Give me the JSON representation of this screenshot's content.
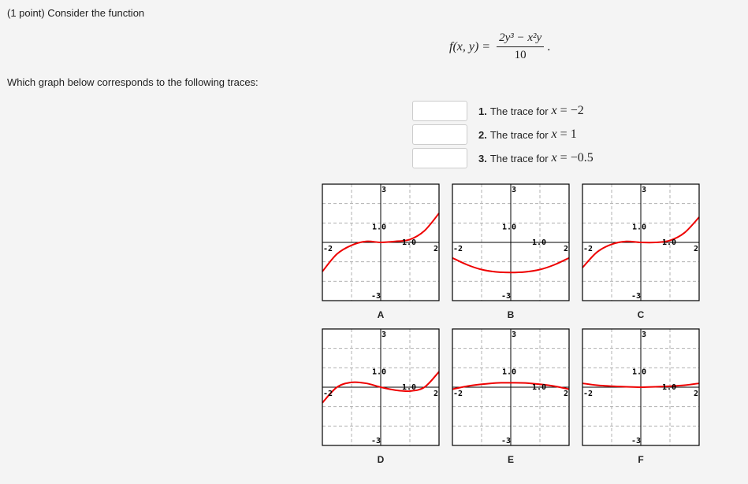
{
  "header": {
    "intro": "(1 point) Consider the function",
    "question": "Which graph below corresponds to the following traces:"
  },
  "formula": {
    "lhs": "f(x, y) =",
    "numerator": "2y³ − x²y",
    "denominator": "10",
    "trailing": "."
  },
  "items": [
    {
      "number": "1.",
      "text": "The trace for",
      "var": "x",
      "eq": "=",
      "value": "−2",
      "answer": ""
    },
    {
      "number": "2.",
      "text": "The trace for",
      "var": "x",
      "eq": "=",
      "value": "1",
      "answer": ""
    },
    {
      "number": "3.",
      "text": "The trace for",
      "var": "x",
      "eq": "=",
      "value": "−0.5",
      "answer": ""
    }
  ],
  "colors": {
    "curve": "#ee0000",
    "grid": "#b0b0b0",
    "axis": "#000000",
    "background": "#f4f4f4"
  },
  "chart_data": [
    {
      "type": "line",
      "title": "A",
      "xlim": [
        -2,
        2
      ],
      "ylim": [
        -3,
        3
      ],
      "tick_labels": {
        "xmin": "-2",
        "xmax": "2",
        "ymax": "3",
        "ymin": "-3",
        "x1": "1.0",
        "y1": "1.0"
      },
      "grid": true,
      "series": [
        {
          "name": "trace",
          "x": [
            -2,
            -1.5,
            -1,
            -0.5,
            0,
            0.5,
            1,
            1.5,
            2
          ],
          "y": [
            -1.5,
            -0.6,
            -0.15,
            0.05,
            0,
            0.05,
            0.15,
            0.6,
            1.5
          ]
        }
      ]
    },
    {
      "type": "line",
      "title": "B",
      "xlim": [
        -2,
        2
      ],
      "ylim": [
        -3,
        3
      ],
      "tick_labels": {
        "xmin": "-2",
        "xmax": "2",
        "ymax": "3",
        "ymin": "-3",
        "x1": "1.0",
        "y1": "1.0"
      },
      "grid": true,
      "series": [
        {
          "name": "trace",
          "x": [
            -2,
            -1.5,
            -1,
            -0.5,
            0,
            0.5,
            1,
            1.5,
            2
          ],
          "y": [
            -0.8,
            -1.15,
            -1.4,
            -1.52,
            -1.55,
            -1.52,
            -1.4,
            -1.15,
            -0.8
          ]
        }
      ]
    },
    {
      "type": "line",
      "title": "C",
      "xlim": [
        -2,
        2
      ],
      "ylim": [
        -3,
        3
      ],
      "tick_labels": {
        "xmin": "-2",
        "xmax": "2",
        "ymax": "3",
        "ymin": "-3",
        "x1": "1.0",
        "y1": "1.0"
      },
      "grid": true,
      "series": [
        {
          "name": "trace",
          "x": [
            -2,
            -1.5,
            -1,
            -0.5,
            0,
            0.5,
            1,
            1.5,
            2
          ],
          "y": [
            -1.3,
            -0.5,
            -0.1,
            0.05,
            0,
            0.0,
            0.1,
            0.5,
            1.3
          ]
        }
      ]
    },
    {
      "type": "line",
      "title": "D",
      "xlim": [
        -2,
        2
      ],
      "ylim": [
        -3,
        3
      ],
      "tick_labels": {
        "xmin": "-2",
        "xmax": "2",
        "ymax": "3",
        "ymin": "-3",
        "x1": "1.0",
        "y1": "1.0"
      },
      "grid": true,
      "series": [
        {
          "name": "trace",
          "x": [
            -2,
            -1.5,
            -1,
            -0.5,
            0,
            0.5,
            1,
            1.5,
            2
          ],
          "y": [
            -0.8,
            0.0,
            0.25,
            0.2,
            0.0,
            -0.15,
            -0.2,
            0.0,
            0.8
          ]
        }
      ]
    },
    {
      "type": "line",
      "title": "E",
      "xlim": [
        -2,
        2
      ],
      "ylim": [
        -3,
        3
      ],
      "tick_labels": {
        "xmin": "-2",
        "xmax": "2",
        "ymax": "3",
        "ymin": "-3",
        "x1": "1.0",
        "y1": "1.0"
      },
      "grid": true,
      "series": [
        {
          "name": "trace",
          "x": [
            -2,
            -1.5,
            -1,
            -0.5,
            0,
            0.5,
            1,
            1.5,
            2
          ],
          "y": [
            -0.1,
            0.05,
            0.15,
            0.22,
            0.23,
            0.22,
            0.15,
            0.05,
            -0.1
          ]
        }
      ]
    },
    {
      "type": "line",
      "title": "F",
      "xlim": [
        -2,
        2
      ],
      "ylim": [
        -3,
        3
      ],
      "tick_labels": {
        "xmin": "-2",
        "xmax": "2",
        "ymax": "3",
        "ymin": "-3",
        "x1": "1.0",
        "y1": "1.0"
      },
      "grid": true,
      "series": [
        {
          "name": "trace",
          "x": [
            -2,
            -1.5,
            -1,
            -0.5,
            0,
            0.5,
            1,
            1.5,
            2
          ],
          "y": [
            0.2,
            0.1,
            0.05,
            0.02,
            0.0,
            0.02,
            0.05,
            0.1,
            0.2
          ]
        }
      ]
    }
  ]
}
